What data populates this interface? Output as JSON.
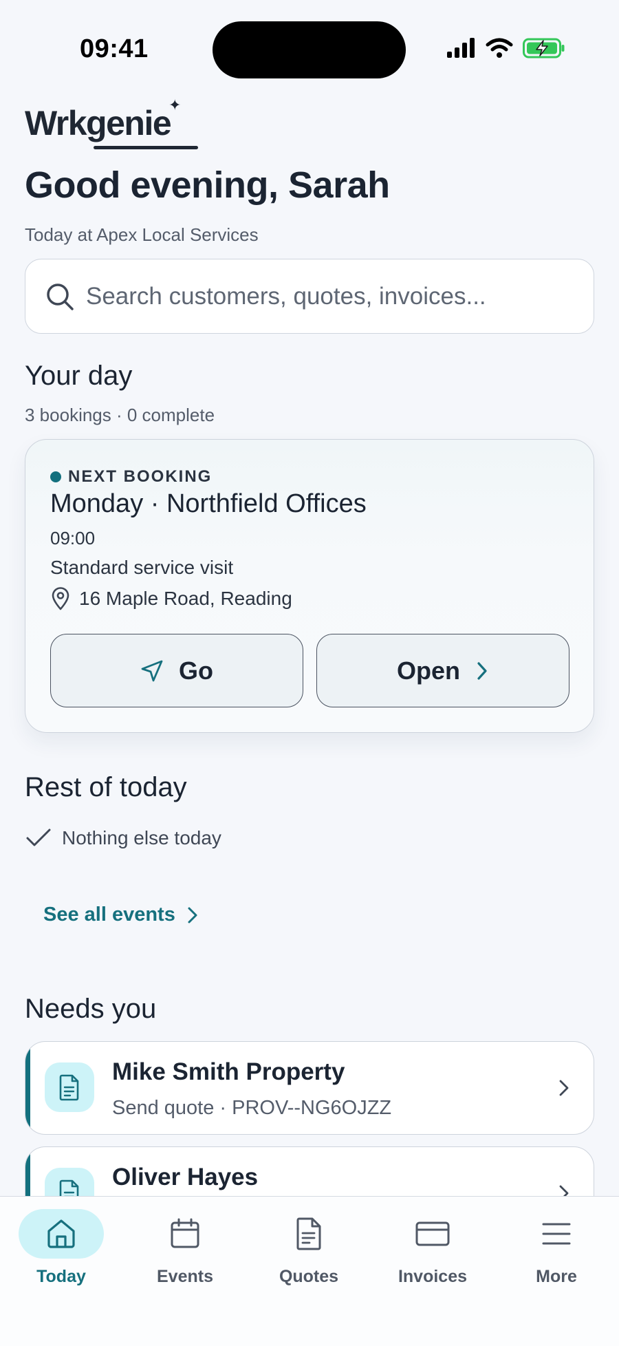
{
  "status_bar": {
    "time": "09:41"
  },
  "app": {
    "logo": "Wrkgenie",
    "greeting": "Good evening, Sarah",
    "subtitle": "Today at Apex Local Services"
  },
  "search": {
    "placeholder": "Search customers, quotes, invoices..."
  },
  "your_day": {
    "title": "Your day",
    "meta": "3 bookings · 0 complete",
    "next_booking": {
      "label": "NEXT BOOKING",
      "title": "Monday · Northfield Offices",
      "time": "09:00",
      "type": "Standard service visit",
      "address": "16 Maple Road, Reading",
      "go_label": "Go",
      "open_label": "Open"
    }
  },
  "rest_of_today": {
    "title": "Rest of today",
    "empty_text": "Nothing else today",
    "see_all": "See all events"
  },
  "needs_you": {
    "title": "Needs you",
    "items": [
      {
        "name": "Mike Smith Property",
        "subtitle": "Send quote · PROV--NG6OJZZ",
        "icon": "document-icon"
      },
      {
        "name": "Oliver Hayes",
        "subtitle": "",
        "icon": "document-icon"
      }
    ]
  },
  "tabs": [
    {
      "label": "Today",
      "icon": "home-icon",
      "active": true
    },
    {
      "label": "Events",
      "icon": "calendar-icon",
      "active": false
    },
    {
      "label": "Quotes",
      "icon": "document-icon",
      "active": false
    },
    {
      "label": "Invoices",
      "icon": "card-icon",
      "active": false
    },
    {
      "label": "More",
      "icon": "menu-icon",
      "active": false
    }
  ],
  "colors": {
    "accent": "#13707e",
    "accent_light": "#cdf3f8",
    "background": "#f5f7fb",
    "text": "#1b2432",
    "battery_green": "#34c759"
  }
}
